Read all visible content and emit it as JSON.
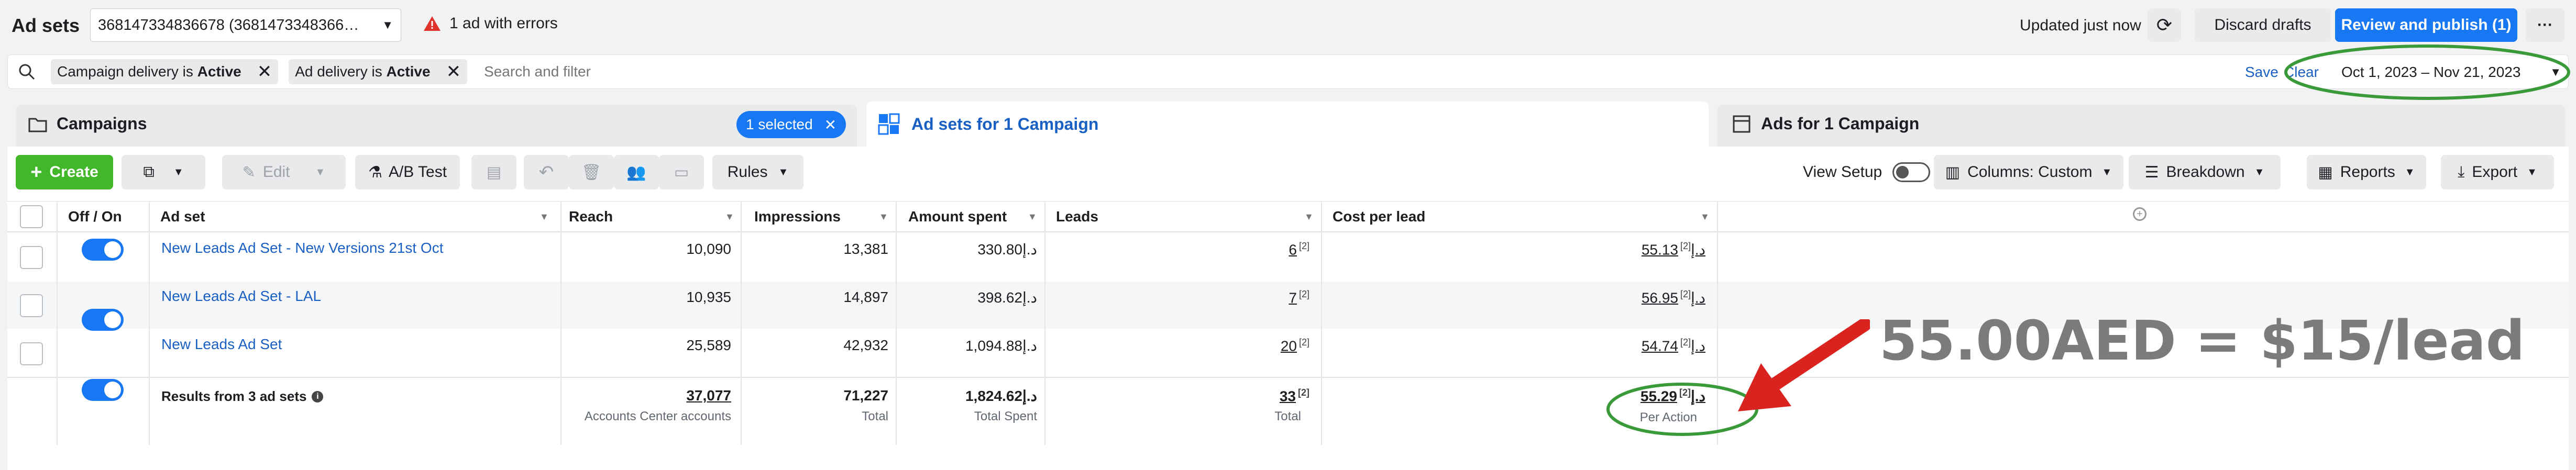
{
  "header": {
    "title": "Ad sets",
    "account_select": "368147334836678 (368147334836678)",
    "error_text": "1 ad with errors",
    "updated": "Updated just now",
    "discard": "Discard drafts",
    "review": "Review and publish (1)",
    "more": "···"
  },
  "filters": {
    "chip1_prefix": "Campaign delivery is ",
    "chip1_value": "Active",
    "chip2_prefix": "Ad delivery is ",
    "chip2_value": "Active",
    "search_placeholder": "Search and filter",
    "save": "Save",
    "clear": "Clear",
    "date_range": "Oct 1, 2023 – Nov 21, 2023"
  },
  "tabs": {
    "campaigns": "Campaigns",
    "selected": "1 selected",
    "adsets": "Ad sets for 1 Campaign",
    "ads": "Ads for 1 Campaign"
  },
  "toolbar": {
    "create": "Create",
    "edit": "Edit",
    "ab_test": "A/B Test",
    "rules": "Rules",
    "view_setup": "View Setup",
    "columns": "Columns: Custom",
    "breakdown": "Breakdown",
    "reports": "Reports",
    "export": "Export"
  },
  "table": {
    "headers": {
      "off_on": "Off / On",
      "adset": "Ad set",
      "reach": "Reach",
      "impressions": "Impressions",
      "amount_spent": "Amount spent",
      "leads": "Leads",
      "cost_per_lead": "Cost per lead"
    },
    "rows": [
      {
        "name": "New Leads Ad Set - New Versions 21st Oct",
        "reach": "10,090",
        "impressions": "13,381",
        "spent": "330.80د.إ",
        "leads": "6",
        "cpl": "55.13د.إ"
      },
      {
        "name": "New Leads Ad Set - LAL",
        "reach": "10,935",
        "impressions": "14,897",
        "spent": "398.62د.إ",
        "leads": "7",
        "cpl": "56.95د.إ"
      },
      {
        "name": "New Leads Ad Set",
        "reach": "25,589",
        "impressions": "42,932",
        "spent": "1,094.88د.إ",
        "leads": "20",
        "cpl": "54.74د.إ"
      }
    ],
    "footnote": "[2]",
    "totals": {
      "label": "Results from 3 ad sets",
      "reach": "37,077",
      "reach_sub": "Accounts Center accounts",
      "impressions": "71,227",
      "impressions_sub": "Total",
      "spent": "1,824.62د.إ",
      "spent_sub": "Total Spent",
      "leads": "33",
      "leads_sub": "Total",
      "cpl": "55.29د.إ",
      "cpl_sub": "Per Action"
    }
  },
  "annotation": {
    "text": "55.00AED = $15/lead",
    "color": "#7b7b7b",
    "arrow_color": "#d9231f",
    "circle_color": "#3a9a3a"
  }
}
